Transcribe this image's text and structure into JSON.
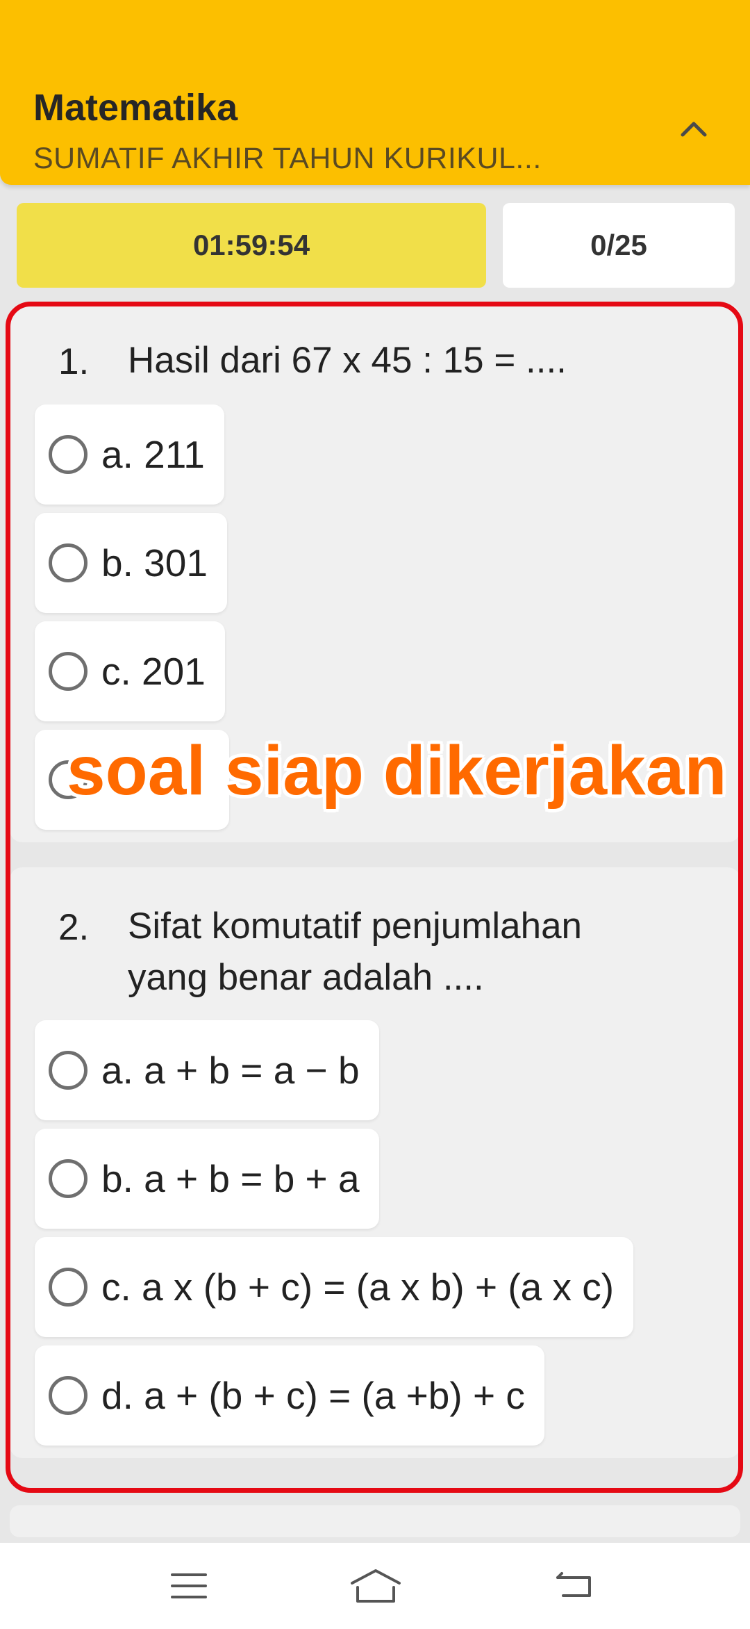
{
  "header": {
    "title": "Matematika",
    "subtitle": "SUMATIF AKHIR TAHUN KURIKUL...",
    "background_color": "#fcbf00",
    "collapse_icon": "chevron-up-icon"
  },
  "status": {
    "timer": "01:59:54",
    "progress": "0/25",
    "timer_color": "#f1df49"
  },
  "questions": [
    {
      "number": "1.",
      "text": "Hasil dari 67 x 45 : 15 = ....",
      "options": [
        {
          "label": "a. 211"
        },
        {
          "label": "b. 301"
        },
        {
          "label": "c. 201"
        },
        {
          "label": ""
        }
      ]
    },
    {
      "number": "2.",
      "text_line1": "Sifat komutatif penjumlahan",
      "text_line2": "yang benar adalah ....",
      "options": [
        {
          "label": "a. a + b = a − b"
        },
        {
          "label": "b. a + b = b + a"
        },
        {
          "label": "c. a x (b + c) = (a x b) + (a x c)"
        },
        {
          "label": "d. a + (b + c) = (a +b) + c"
        }
      ]
    }
  ],
  "overlay": {
    "caption": "soal siap dikerjakan",
    "caption_color": "#ff6a00",
    "frame_color": "#e50914"
  },
  "navigation": {
    "menu_icon": "menu-icon",
    "home_icon": "home-icon",
    "back_icon": "back-icon"
  }
}
